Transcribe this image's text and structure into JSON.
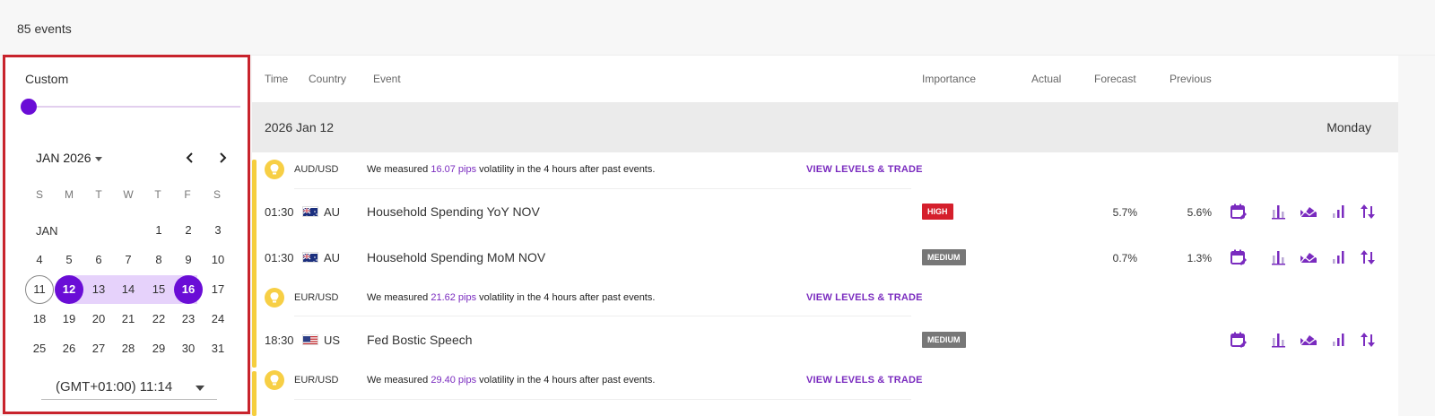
{
  "header": {
    "event_count": "85 events"
  },
  "filter": {
    "range_label": "Custom",
    "month_label": "JAN 2026",
    "weekdays": [
      "S",
      "M",
      "T",
      "W",
      "T",
      "F",
      "S"
    ],
    "month_short": "JAN",
    "days": [
      "1",
      "2",
      "3",
      "4",
      "5",
      "6",
      "7",
      "8",
      "9",
      "10",
      "11",
      "12",
      "13",
      "14",
      "15",
      "16",
      "17",
      "18",
      "19",
      "20",
      "21",
      "22",
      "23",
      "24",
      "25",
      "26",
      "27",
      "28",
      "29",
      "30",
      "31"
    ],
    "timezone": "(GMT+01:00) 11:14",
    "accent_color": "#6a0dd6"
  },
  "table": {
    "columns": {
      "time": "Time",
      "country": "Country",
      "event": "Event",
      "importance": "Importance",
      "actual": "Actual",
      "forecast": "Forecast",
      "previous": "Previous"
    },
    "date": "2026 Jan 12",
    "weekday": "Monday",
    "groups": [
      {
        "pair": "AUD/USD",
        "vol_prefix": "We measured ",
        "pips": "16.07 pips",
        "vol_suffix": " volatility in the 4 hours after past events.",
        "link": "VIEW LEVELS & TRADE",
        "rows": [
          {
            "time": "01:30",
            "country": "AU",
            "flag": "au-flag",
            "event": "Household Spending YoY NOV",
            "importance": "HIGH",
            "actual": "",
            "forecast": "5.7%",
            "previous": "5.6%"
          },
          {
            "time": "01:30",
            "country": "AU",
            "flag": "au-flag",
            "event": "Household Spending MoM NOV",
            "importance": "MEDIUM",
            "actual": "",
            "forecast": "0.7%",
            "previous": "1.3%"
          }
        ]
      },
      {
        "pair": "EUR/USD",
        "vol_prefix": "We measured ",
        "pips": "21.62 pips",
        "vol_suffix": " volatility in the 4 hours after past events.",
        "link": "VIEW LEVELS & TRADE",
        "rows": [
          {
            "time": "18:30",
            "country": "US",
            "flag": "us-flag",
            "event": "Fed Bostic Speech",
            "importance": "MEDIUM",
            "actual": "",
            "forecast": "",
            "previous": ""
          }
        ]
      },
      {
        "pair": "EUR/USD",
        "vol_prefix": "We measured ",
        "pips": "29.40 pips",
        "vol_suffix": " volatility in the 4 hours after past events.",
        "link": "VIEW LEVELS & TRADE",
        "rows": []
      }
    ],
    "action_icons": [
      "calendar-edit-icon",
      "bar-chart-icon",
      "area-chart-icon",
      "signal-chart-icon",
      "sort-arrows-icon"
    ],
    "colors": {
      "high": "#d51f2c",
      "medium": "#777777",
      "purple": "#7a2bbf",
      "yellow": "#f5ce3e"
    }
  }
}
